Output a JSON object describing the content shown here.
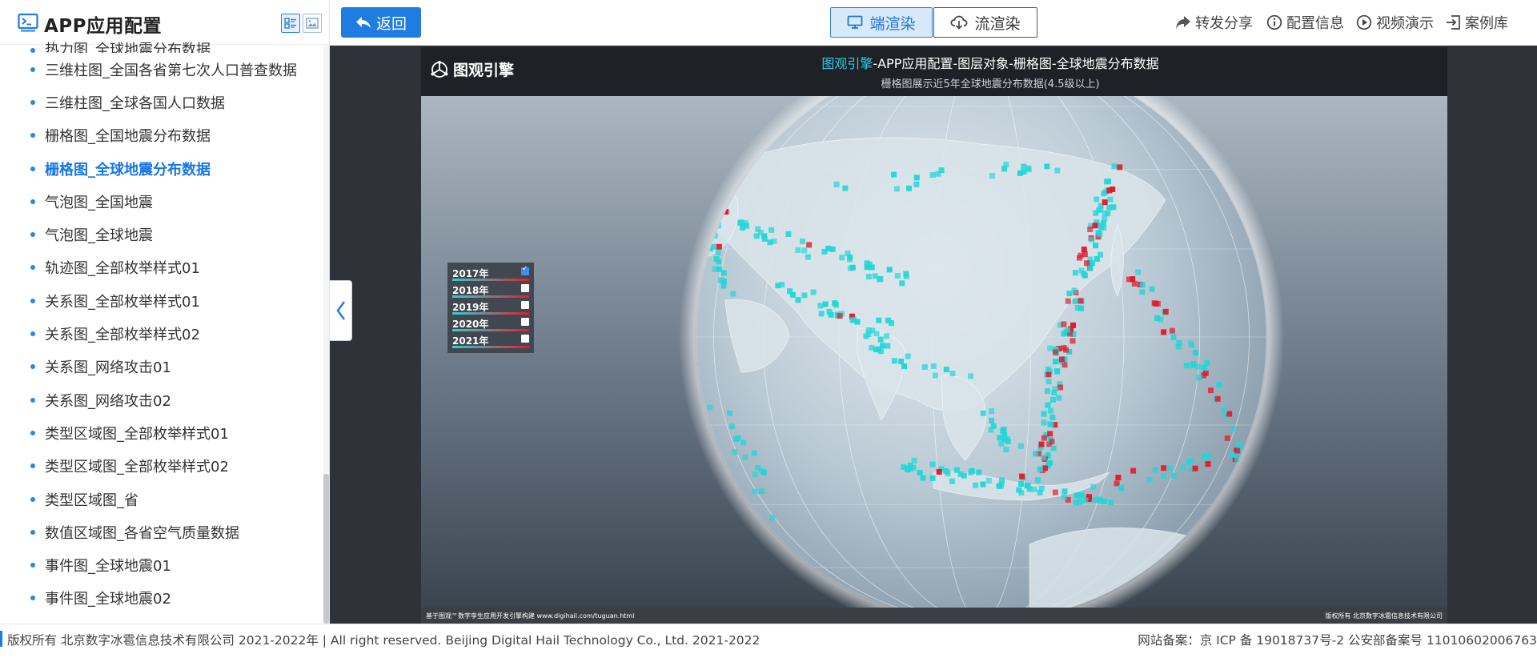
{
  "sidebar": {
    "title": "APP应用配置",
    "items": [
      {
        "label": "热力图_全球地震分布数据",
        "active": false
      },
      {
        "label": "三维柱图_全国各省第七次人口普查数据",
        "active": false
      },
      {
        "label": "三维柱图_全球各国人口数据",
        "active": false
      },
      {
        "label": "栅格图_全国地震分布数据",
        "active": false
      },
      {
        "label": "栅格图_全球地震分布数据",
        "active": true
      },
      {
        "label": "气泡图_全国地震",
        "active": false
      },
      {
        "label": "气泡图_全球地震",
        "active": false
      },
      {
        "label": "轨迹图_全部枚举样式01",
        "active": false
      },
      {
        "label": "关系图_全部枚举样式01",
        "active": false
      },
      {
        "label": "关系图_全部枚举样式02",
        "active": false
      },
      {
        "label": "关系图_网络攻击01",
        "active": false
      },
      {
        "label": "关系图_网络攻击02",
        "active": false
      },
      {
        "label": "类型区域图_全部枚举样式01",
        "active": false
      },
      {
        "label": "类型区域图_全部枚举样式02",
        "active": false
      },
      {
        "label": "类型区域图_省",
        "active": false
      },
      {
        "label": "数值区域图_各省空气质量数据",
        "active": false
      },
      {
        "label": "事件图_全球地震01",
        "active": false
      },
      {
        "label": "事件图_全球地震02",
        "active": false
      }
    ]
  },
  "toolbar": {
    "back_label": "返回",
    "render_client_label": "端渲染",
    "render_stream_label": "流渲染",
    "share_label": "转发分享",
    "config_label": "配置信息",
    "video_label": "视频演示",
    "cases_label": "案例库"
  },
  "viewport": {
    "brand": "图观引擎",
    "title_accent": "图观引擎",
    "title_rest": "-APP应用配置-图层对象-栅格图-全球地震分布数据",
    "subtitle": "栅格图展示近5年全球地震分布数据(4.5级以上)",
    "footer_left": "基于图观™数字孪生应用开发引擎构建 www.digihail.com/tuguan.html",
    "footer_right": "版权所有 北京数字冰雹信息技术有限公司",
    "legend": [
      {
        "year": "2017年",
        "checked": true
      },
      {
        "year": "2018年",
        "checked": false
      },
      {
        "year": "2019年",
        "checked": false
      },
      {
        "year": "2020年",
        "checked": false
      },
      {
        "year": "2021年",
        "checked": false
      }
    ],
    "colors": {
      "low": "#22d6d6",
      "high": "#e3192a"
    }
  },
  "footer": {
    "copyright": "版权所有 北京数字冰雹信息技术有限公司 2021-2022年 | All right reserved. Beijing Digital Hail Technology Co., Ltd. 2021-2022",
    "beian": "网站备案：京 ICP 备 19018737号-2 公安部备案号 11010602006763"
  }
}
